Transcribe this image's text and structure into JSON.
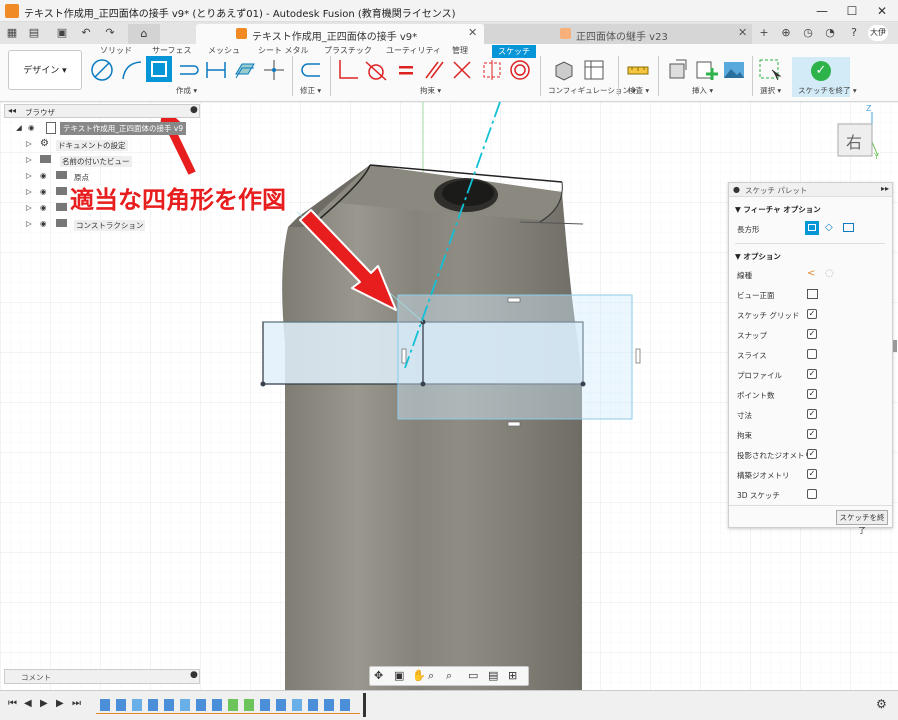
{
  "window": {
    "title": "テキスト作成用_正四面体の接手 v9* (とりあえず01) - Autodesk Fusion (教育機関ライセンス)",
    "minimize": "—",
    "maximize": "☐",
    "close": "✕"
  },
  "tabs": [
    {
      "label": "テキスト作成用_正四面体の接手 v9*",
      "close": "✕"
    },
    {
      "label": "正四面体の継手 v23",
      "close": "✕"
    }
  ],
  "user_avatar": "大伊",
  "ribbon": {
    "menu_tabs": [
      "ソリッド",
      "サーフェス",
      "メッシュ",
      "シート メタル",
      "プラスチック",
      "ユーティリティ",
      "管理",
      "スケッチ"
    ],
    "design_button": "デザイン ▾",
    "groups": {
      "create": "作成 ▾",
      "modify": "修正 ▾",
      "constraints": "拘束 ▾",
      "configure": "コンフィギュレーション ▾",
      "inspect": "検査 ▾",
      "insert": "挿入 ▾",
      "select": "選択 ▾",
      "finish": "スケッチを終了 ▾"
    }
  },
  "browser": {
    "title": "ブラウザ",
    "root": "テキスト作成用_正四面体の接手 v9",
    "items": [
      "ドキュメントの設定",
      "名前の付いたビュー",
      "原点",
      "",
      "",
      "コンストラクション"
    ]
  },
  "viewcube": {
    "label": "右",
    "axis_z": "Z",
    "axis_y": "Y"
  },
  "annotation": "適当な四角形を作図",
  "palette": {
    "title": "スケッチ パレット",
    "feature_options_header": "フィーチャ オプション",
    "rectangle_label": "長方形",
    "options_header": "オプション",
    "rows": [
      {
        "label": "線種",
        "type": "icons"
      },
      {
        "label": "ビュー正面",
        "type": "icon"
      },
      {
        "label": "スケッチ グリッド",
        "checked": true
      },
      {
        "label": "スナップ",
        "checked": true
      },
      {
        "label": "スライス",
        "checked": false
      },
      {
        "label": "プロファイル",
        "checked": true
      },
      {
        "label": "ポイント数",
        "checked": true
      },
      {
        "label": "寸法",
        "checked": true
      },
      {
        "label": "拘束",
        "checked": true
      },
      {
        "label": "投影されたジオメトリ",
        "checked": true
      },
      {
        "label": "構築ジオメトリ",
        "checked": true
      },
      {
        "label": "3D スケッチ",
        "checked": false
      }
    ],
    "finish_button": "スケッチを終了"
  },
  "comments": {
    "label": "コメント"
  },
  "colors": {
    "accent": "#0696d7",
    "annotation_red": "#e81d1d",
    "finish_green": "#2db34a",
    "body_grey": "#8a887e"
  }
}
